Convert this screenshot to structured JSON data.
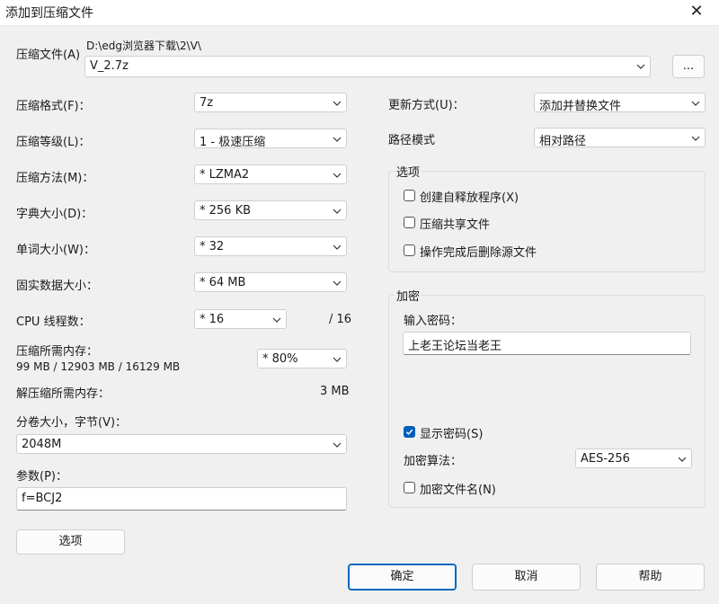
{
  "window": {
    "title": "添加到压缩文件"
  },
  "archive": {
    "label": "压缩文件(A)",
    "path": "D:\\edg浏览器下载\\2\\V\\",
    "name": "V_2.7z",
    "browse_label": "..."
  },
  "left": {
    "format": {
      "label": "压缩格式(F)：",
      "value": "7z"
    },
    "level": {
      "label": "压缩等级(L)：",
      "value": "1 - 极速压缩"
    },
    "method": {
      "label": "压缩方法(M)：",
      "value": "* LZMA2"
    },
    "dict": {
      "label": "字典大小(D)：",
      "value": "* 256 KB"
    },
    "word": {
      "label": "单词大小(W)：",
      "value": "* 32"
    },
    "solid": {
      "label": "固实数据大小：",
      "value": "* 64 MB"
    },
    "cpu": {
      "label": "CPU 线程数：",
      "value": "* 16",
      "max": "/ 16"
    },
    "mem": {
      "label": "压缩所需内存：",
      "detail": "99 MB / 12903 MB / 16129 MB",
      "value": "* 80%"
    },
    "decomp": {
      "label": "解压缩所需内存：",
      "value": "3 MB"
    },
    "split": {
      "label": "分卷大小，字节(V)：",
      "value": "2048M"
    },
    "params": {
      "label": "参数(P)：",
      "value": "f=BCJ2"
    },
    "options_button": "选项"
  },
  "right": {
    "update": {
      "label": "更新方式(U)：",
      "value": "添加并替换文件"
    },
    "path_mode": {
      "label": "路径模式",
      "value": "相对路径"
    },
    "options_group": {
      "title": "选项",
      "items": [
        {
          "label": "创建自释放程序(X)",
          "checked": false
        },
        {
          "label": "压缩共享文件",
          "checked": false
        },
        {
          "label": "操作完成后删除源文件",
          "checked": false
        }
      ]
    },
    "encryption": {
      "title": "加密",
      "password_label": "输入密码：",
      "password_value": "上老王论坛当老王",
      "show_password_label": "显示密码(S)",
      "show_password_checked": true,
      "method_label": "加密算法：",
      "method_value": "AES-256",
      "encrypt_names_label": "加密文件名(N)",
      "encrypt_names_checked": false
    }
  },
  "footer": {
    "ok": "确定",
    "cancel": "取消",
    "help": "帮助"
  },
  "colors": {
    "accent": "#005fb8",
    "background": "#f0f0f0"
  }
}
